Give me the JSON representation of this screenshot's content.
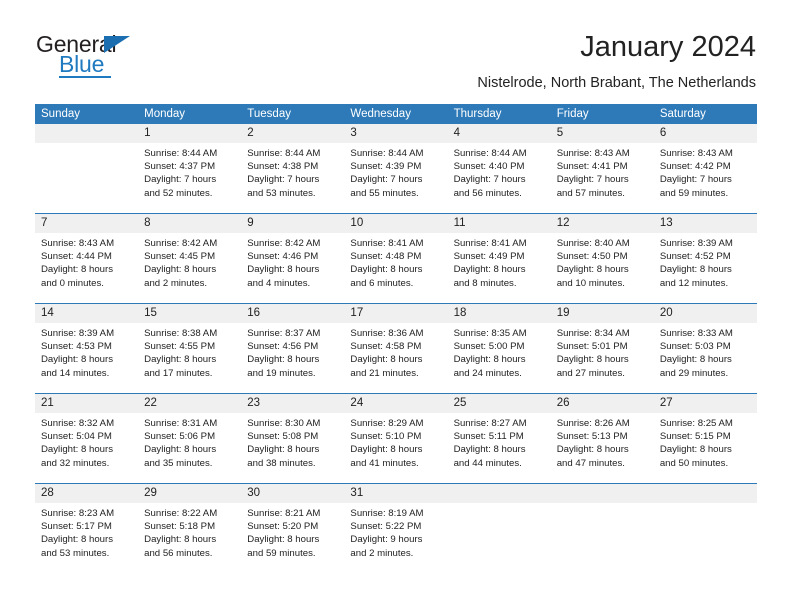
{
  "brand": {
    "name_top": "General",
    "name_bottom": "Blue",
    "triangle_icon": "triangle-icon",
    "accent_color": "#1f7ac0"
  },
  "header": {
    "title": "January 2024",
    "subtitle": "Nistelrode, North Brabant, The Netherlands"
  },
  "colors": {
    "header_row_bg": "#2e7ab8",
    "day_number_bg": "#f0f0f0",
    "text": "#222222",
    "cell_bg": "#ffffff"
  },
  "calendar": {
    "day_headers": [
      "Sunday",
      "Monday",
      "Tuesday",
      "Wednesday",
      "Thursday",
      "Friday",
      "Saturday"
    ],
    "labels": {
      "sunrise": "Sunrise:",
      "sunset": "Sunset:",
      "daylight": "Daylight:"
    },
    "weeks": [
      [
        {
          "day": "",
          "lines": []
        },
        {
          "day": "1",
          "lines": [
            "Sunrise: 8:44 AM",
            "Sunset: 4:37 PM",
            "Daylight: 7 hours",
            "and 52 minutes."
          ]
        },
        {
          "day": "2",
          "lines": [
            "Sunrise: 8:44 AM",
            "Sunset: 4:38 PM",
            "Daylight: 7 hours",
            "and 53 minutes."
          ]
        },
        {
          "day": "3",
          "lines": [
            "Sunrise: 8:44 AM",
            "Sunset: 4:39 PM",
            "Daylight: 7 hours",
            "and 55 minutes."
          ]
        },
        {
          "day": "4",
          "lines": [
            "Sunrise: 8:44 AM",
            "Sunset: 4:40 PM",
            "Daylight: 7 hours",
            "and 56 minutes."
          ]
        },
        {
          "day": "5",
          "lines": [
            "Sunrise: 8:43 AM",
            "Sunset: 4:41 PM",
            "Daylight: 7 hours",
            "and 57 minutes."
          ]
        },
        {
          "day": "6",
          "lines": [
            "Sunrise: 8:43 AM",
            "Sunset: 4:42 PM",
            "Daylight: 7 hours",
            "and 59 minutes."
          ]
        }
      ],
      [
        {
          "day": "7",
          "lines": [
            "Sunrise: 8:43 AM",
            "Sunset: 4:44 PM",
            "Daylight: 8 hours",
            "and 0 minutes."
          ]
        },
        {
          "day": "8",
          "lines": [
            "Sunrise: 8:42 AM",
            "Sunset: 4:45 PM",
            "Daylight: 8 hours",
            "and 2 minutes."
          ]
        },
        {
          "day": "9",
          "lines": [
            "Sunrise: 8:42 AM",
            "Sunset: 4:46 PM",
            "Daylight: 8 hours",
            "and 4 minutes."
          ]
        },
        {
          "day": "10",
          "lines": [
            "Sunrise: 8:41 AM",
            "Sunset: 4:48 PM",
            "Daylight: 8 hours",
            "and 6 minutes."
          ]
        },
        {
          "day": "11",
          "lines": [
            "Sunrise: 8:41 AM",
            "Sunset: 4:49 PM",
            "Daylight: 8 hours",
            "and 8 minutes."
          ]
        },
        {
          "day": "12",
          "lines": [
            "Sunrise: 8:40 AM",
            "Sunset: 4:50 PM",
            "Daylight: 8 hours",
            "and 10 minutes."
          ]
        },
        {
          "day": "13",
          "lines": [
            "Sunrise: 8:39 AM",
            "Sunset: 4:52 PM",
            "Daylight: 8 hours",
            "and 12 minutes."
          ]
        }
      ],
      [
        {
          "day": "14",
          "lines": [
            "Sunrise: 8:39 AM",
            "Sunset: 4:53 PM",
            "Daylight: 8 hours",
            "and 14 minutes."
          ]
        },
        {
          "day": "15",
          "lines": [
            "Sunrise: 8:38 AM",
            "Sunset: 4:55 PM",
            "Daylight: 8 hours",
            "and 17 minutes."
          ]
        },
        {
          "day": "16",
          "lines": [
            "Sunrise: 8:37 AM",
            "Sunset: 4:56 PM",
            "Daylight: 8 hours",
            "and 19 minutes."
          ]
        },
        {
          "day": "17",
          "lines": [
            "Sunrise: 8:36 AM",
            "Sunset: 4:58 PM",
            "Daylight: 8 hours",
            "and 21 minutes."
          ]
        },
        {
          "day": "18",
          "lines": [
            "Sunrise: 8:35 AM",
            "Sunset: 5:00 PM",
            "Daylight: 8 hours",
            "and 24 minutes."
          ]
        },
        {
          "day": "19",
          "lines": [
            "Sunrise: 8:34 AM",
            "Sunset: 5:01 PM",
            "Daylight: 8 hours",
            "and 27 minutes."
          ]
        },
        {
          "day": "20",
          "lines": [
            "Sunrise: 8:33 AM",
            "Sunset: 5:03 PM",
            "Daylight: 8 hours",
            "and 29 minutes."
          ]
        }
      ],
      [
        {
          "day": "21",
          "lines": [
            "Sunrise: 8:32 AM",
            "Sunset: 5:04 PM",
            "Daylight: 8 hours",
            "and 32 minutes."
          ]
        },
        {
          "day": "22",
          "lines": [
            "Sunrise: 8:31 AM",
            "Sunset: 5:06 PM",
            "Daylight: 8 hours",
            "and 35 minutes."
          ]
        },
        {
          "day": "23",
          "lines": [
            "Sunrise: 8:30 AM",
            "Sunset: 5:08 PM",
            "Daylight: 8 hours",
            "and 38 minutes."
          ]
        },
        {
          "day": "24",
          "lines": [
            "Sunrise: 8:29 AM",
            "Sunset: 5:10 PM",
            "Daylight: 8 hours",
            "and 41 minutes."
          ]
        },
        {
          "day": "25",
          "lines": [
            "Sunrise: 8:27 AM",
            "Sunset: 5:11 PM",
            "Daylight: 8 hours",
            "and 44 minutes."
          ]
        },
        {
          "day": "26",
          "lines": [
            "Sunrise: 8:26 AM",
            "Sunset: 5:13 PM",
            "Daylight: 8 hours",
            "and 47 minutes."
          ]
        },
        {
          "day": "27",
          "lines": [
            "Sunrise: 8:25 AM",
            "Sunset: 5:15 PM",
            "Daylight: 8 hours",
            "and 50 minutes."
          ]
        }
      ],
      [
        {
          "day": "28",
          "lines": [
            "Sunrise: 8:23 AM",
            "Sunset: 5:17 PM",
            "Daylight: 8 hours",
            "and 53 minutes."
          ]
        },
        {
          "day": "29",
          "lines": [
            "Sunrise: 8:22 AM",
            "Sunset: 5:18 PM",
            "Daylight: 8 hours",
            "and 56 minutes."
          ]
        },
        {
          "day": "30",
          "lines": [
            "Sunrise: 8:21 AM",
            "Sunset: 5:20 PM",
            "Daylight: 8 hours",
            "and 59 minutes."
          ]
        },
        {
          "day": "31",
          "lines": [
            "Sunrise: 8:19 AM",
            "Sunset: 5:22 PM",
            "Daylight: 9 hours",
            "and 2 minutes."
          ]
        },
        {
          "day": "",
          "lines": []
        },
        {
          "day": "",
          "lines": []
        },
        {
          "day": "",
          "lines": []
        }
      ]
    ]
  }
}
